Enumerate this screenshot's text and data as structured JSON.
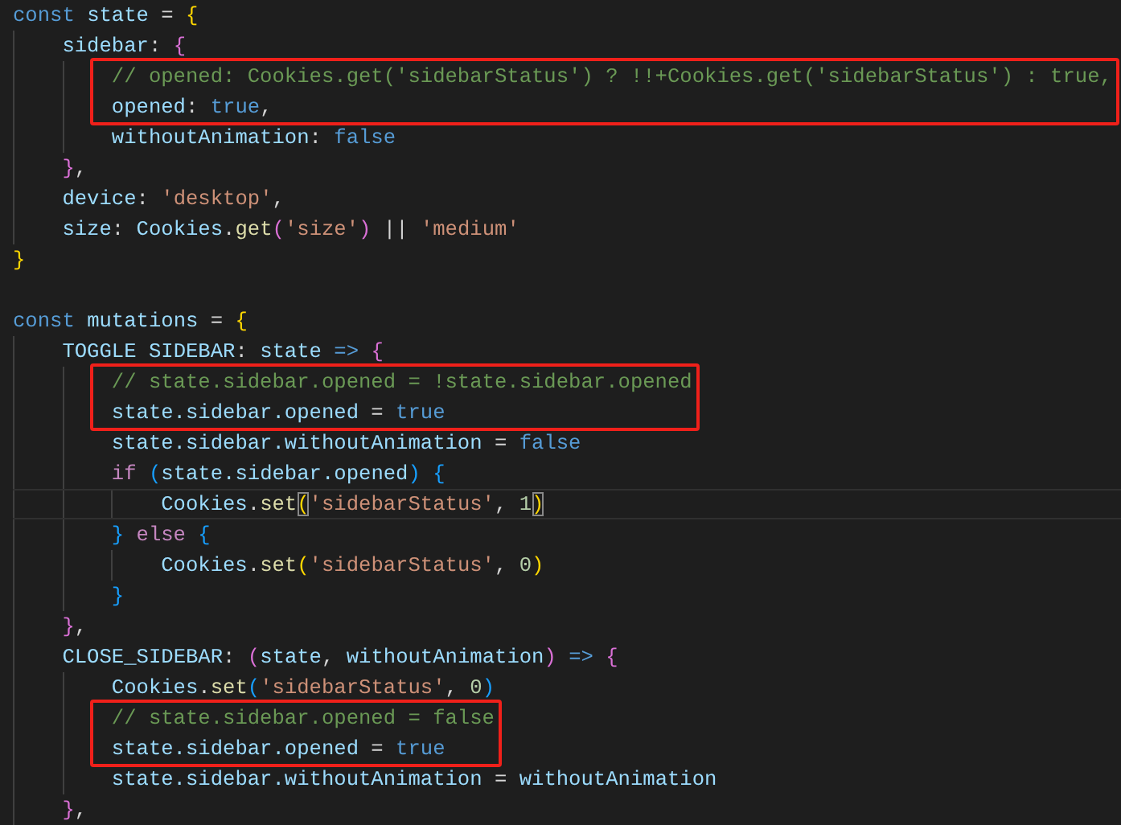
{
  "editor": {
    "lines": [
      {
        "kind": "code",
        "tokens": [
          {
            "text": "const ",
            "kind": "kw"
          },
          {
            "text": "state",
            "kind": "var"
          },
          {
            "text": " = ",
            "kind": "p"
          },
          {
            "text": "{",
            "kind": "b1"
          }
        ]
      },
      {
        "kind": "code",
        "tokens": [
          {
            "text": "    sidebar",
            "kind": "prop"
          },
          {
            "text": ": ",
            "kind": "p"
          },
          {
            "text": "{",
            "kind": "b2"
          }
        ]
      },
      {
        "kind": "highlight",
        "lines": [
          {
            "kind": "code",
            "tokens": [
              {
                "text": "        // opened: Cookies.get('sidebarStatus') ? !!+Cookies.get('sidebarStatus') : true,",
                "kind": "cm"
              }
            ]
          },
          {
            "kind": "code",
            "tokens": [
              {
                "text": "        opened",
                "kind": "prop"
              },
              {
                "text": ": ",
                "kind": "p"
              },
              {
                "text": "true",
                "kind": "kw"
              },
              {
                "text": ",",
                "kind": "p"
              }
            ]
          }
        ]
      },
      {
        "kind": "code",
        "tokens": [
          {
            "text": "        withoutAnimation",
            "kind": "prop"
          },
          {
            "text": ": ",
            "kind": "p"
          },
          {
            "text": "false",
            "kind": "kw"
          }
        ]
      },
      {
        "kind": "code",
        "tokens": [
          {
            "text": "    }",
            "kind": "b2"
          },
          {
            "text": ",",
            "kind": "p"
          }
        ]
      },
      {
        "kind": "code",
        "tokens": [
          {
            "text": "    device",
            "kind": "prop"
          },
          {
            "text": ": ",
            "kind": "p"
          },
          {
            "text": "'desktop'",
            "kind": "str"
          },
          {
            "text": ",",
            "kind": "p"
          }
        ]
      },
      {
        "kind": "code",
        "tokens": [
          {
            "text": "    size",
            "kind": "prop"
          },
          {
            "text": ": ",
            "kind": "p"
          },
          {
            "text": "Cookies",
            "kind": "var"
          },
          {
            "text": ".",
            "kind": "p"
          },
          {
            "text": "get",
            "kind": "fn"
          },
          {
            "text": "(",
            "kind": "b2"
          },
          {
            "text": "'size'",
            "kind": "str"
          },
          {
            "text": ")",
            "kind": "b2"
          },
          {
            "text": " || ",
            "kind": "p"
          },
          {
            "text": "'medium'",
            "kind": "str"
          }
        ]
      },
      {
        "kind": "code",
        "tokens": [
          {
            "text": "}",
            "kind": "b1"
          }
        ]
      },
      {
        "kind": "blank"
      },
      {
        "kind": "code",
        "tokens": [
          {
            "text": "const ",
            "kind": "kw"
          },
          {
            "text": "mutations",
            "kind": "var"
          },
          {
            "text": " = ",
            "kind": "p"
          },
          {
            "text": "{",
            "kind": "b1"
          }
        ]
      },
      {
        "kind": "code",
        "tokens": [
          {
            "text": "    TOGGLE SIDEBAR",
            "kind": "prop"
          },
          {
            "text": ": ",
            "kind": "p"
          },
          {
            "text": "state ",
            "kind": "var"
          },
          {
            "text": "=> ",
            "kind": "kw"
          },
          {
            "text": "{",
            "kind": "b2"
          }
        ]
      },
      {
        "kind": "highlight",
        "lines": [
          {
            "kind": "code",
            "tokens": [
              {
                "text": "        // state.sidebar.opened = !state.sidebar.opened",
                "kind": "cm"
              }
            ]
          },
          {
            "kind": "code",
            "tokens": [
              {
                "text": "        state.sidebar.opened",
                "kind": "var"
              },
              {
                "text": " = ",
                "kind": "p"
              },
              {
                "text": "true",
                "kind": "kw"
              }
            ]
          }
        ]
      },
      {
        "kind": "code",
        "tokens": [
          {
            "text": "        state.sidebar.withoutAnimation",
            "kind": "var"
          },
          {
            "text": " = ",
            "kind": "p"
          },
          {
            "text": "false",
            "kind": "kw"
          }
        ]
      },
      {
        "kind": "code",
        "tokens": [
          {
            "text": "        if ",
            "kind": "ctl"
          },
          {
            "text": "(",
            "kind": "b3"
          },
          {
            "text": "state.sidebar.opened",
            "kind": "var"
          },
          {
            "text": ") ",
            "kind": "b3"
          },
          {
            "text": "{",
            "kind": "b3"
          }
        ]
      },
      {
        "kind": "code",
        "current": true,
        "tokens": [
          {
            "text": "            Cookies",
            "kind": "var"
          },
          {
            "text": ".",
            "kind": "p"
          },
          {
            "text": "set",
            "kind": "fn"
          },
          {
            "text": "(",
            "kind": "b1",
            "match": true
          },
          {
            "text": "'sidebarStatus'",
            "kind": "str"
          },
          {
            "text": ", ",
            "kind": "p"
          },
          {
            "text": "1",
            "kind": "num"
          },
          {
            "text": ")",
            "kind": "b1",
            "match": true
          }
        ]
      },
      {
        "kind": "code",
        "tokens": [
          {
            "text": "        } ",
            "kind": "b3"
          },
          {
            "text": "else ",
            "kind": "ctl"
          },
          {
            "text": "{",
            "kind": "b3"
          }
        ]
      },
      {
        "kind": "code",
        "tokens": [
          {
            "text": "            Cookies",
            "kind": "var"
          },
          {
            "text": ".",
            "kind": "p"
          },
          {
            "text": "set",
            "kind": "fn"
          },
          {
            "text": "(",
            "kind": "b1"
          },
          {
            "text": "'sidebarStatus'",
            "kind": "str"
          },
          {
            "text": ", ",
            "kind": "p"
          },
          {
            "text": "0",
            "kind": "num"
          },
          {
            "text": ")",
            "kind": "b1"
          }
        ]
      },
      {
        "kind": "code",
        "tokens": [
          {
            "text": "        }",
            "kind": "b3"
          }
        ]
      },
      {
        "kind": "code",
        "tokens": [
          {
            "text": "    }",
            "kind": "b2"
          },
          {
            "text": ",",
            "kind": "p"
          }
        ]
      },
      {
        "kind": "code",
        "tokens": [
          {
            "text": "    CLOSE_SIDEBAR",
            "kind": "prop"
          },
          {
            "text": ": ",
            "kind": "p"
          },
          {
            "text": "(",
            "kind": "b2"
          },
          {
            "text": "state",
            "kind": "var"
          },
          {
            "text": ", ",
            "kind": "p"
          },
          {
            "text": "withoutAnimation",
            "kind": "var"
          },
          {
            "text": ") ",
            "kind": "b2"
          },
          {
            "text": "=> ",
            "kind": "kw"
          },
          {
            "text": "{",
            "kind": "b2"
          }
        ]
      },
      {
        "kind": "code",
        "tokens": [
          {
            "text": "        Cookies",
            "kind": "var"
          },
          {
            "text": ".",
            "kind": "p"
          },
          {
            "text": "set",
            "kind": "fn"
          },
          {
            "text": "(",
            "kind": "b3"
          },
          {
            "text": "'sidebarStatus'",
            "kind": "str"
          },
          {
            "text": ", ",
            "kind": "p"
          },
          {
            "text": "0",
            "kind": "num"
          },
          {
            "text": ")",
            "kind": "b3"
          }
        ]
      },
      {
        "kind": "highlight",
        "lines": [
          {
            "kind": "code",
            "tokens": [
              {
                "text": "        // state.sidebar.opened = false",
                "kind": "cm"
              }
            ]
          },
          {
            "kind": "code",
            "tokens": [
              {
                "text": "        state.sidebar.opened",
                "kind": "var"
              },
              {
                "text": " = ",
                "kind": "p"
              },
              {
                "text": "true",
                "kind": "kw"
              }
            ]
          }
        ]
      },
      {
        "kind": "code",
        "tokens": [
          {
            "text": "        state.sidebar.withoutAnimation",
            "kind": "var"
          },
          {
            "text": " = ",
            "kind": "p"
          },
          {
            "text": "withoutAnimation",
            "kind": "var"
          }
        ]
      },
      {
        "kind": "code",
        "tokens": [
          {
            "text": "    }",
            "kind": "b2"
          },
          {
            "text": ",",
            "kind": "p"
          }
        ]
      }
    ]
  }
}
